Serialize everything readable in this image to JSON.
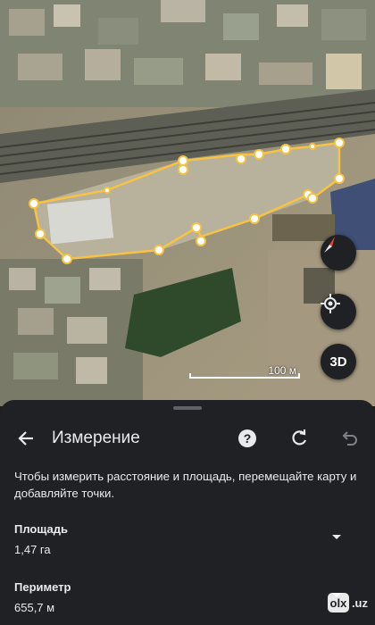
{
  "map": {
    "scale_label": "100 м",
    "button_3d_label": "3D",
    "colors": {
      "measure_line": "#f6c343",
      "compass_red": "#ea4335",
      "sheet_bg": "#202124"
    }
  },
  "sheet": {
    "title": "Измерение",
    "hint": "Чтобы измерить расстояние и площадь, перемещайте карту и добавляйте точки.",
    "area": {
      "label": "Площадь",
      "value": "1,47 га"
    },
    "perimeter": {
      "label": "Периметр",
      "value": "655,7 м"
    },
    "icons": [
      "back-arrow-icon",
      "help-icon",
      "redo-icon",
      "undo-icon",
      "chevron-down-icon"
    ]
  },
  "watermark": {
    "logo": "olx",
    "domain": ".uz"
  }
}
